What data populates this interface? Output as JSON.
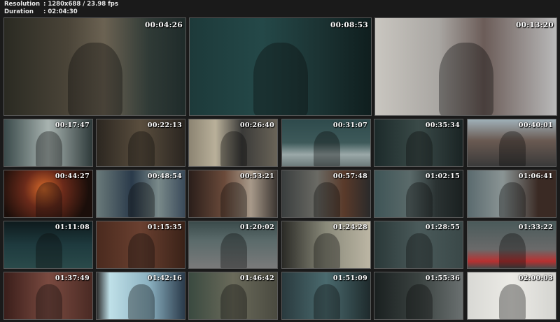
{
  "header": {
    "resolution_label": "Resolution",
    "resolution_value": ": 1280x688 / 23.98 fps",
    "duration_label": "Duration",
    "duration_value": ": 02:04:30"
  },
  "thumbnails": [
    {
      "time": "00:04:26",
      "bg": "linear-gradient(90deg,#2a2a22 0%,#4a4438 35%,#6b6252 55%,#2f3a36 80%,#1f2b2a 100%)"
    },
    {
      "time": "00:08:53",
      "bg": "linear-gradient(90deg,#1d3a3a 0%,#244848 40%,#1c3434 70%,#0f1e1e 100%)"
    },
    {
      "time": "00:13:20",
      "bg": "linear-gradient(90deg,#c9c6c0 0%,#a9a6a2 35%,#6b5c58 60%,#b9b9b9 100%)"
    },
    {
      "time": "00:17:47",
      "bg": "linear-gradient(90deg,#3a4a4a,#a8b3b0 50%,#2e3a3a)"
    },
    {
      "time": "00:22:13",
      "bg": "linear-gradient(90deg,#2b2620,#5a4e3e 50%,#2a2520)"
    },
    {
      "time": "00:26:40",
      "bg": "linear-gradient(90deg,#8c8472,#b9b09a 30%,#3a3a38 60%,#6a6458)"
    },
    {
      "time": "00:31:07",
      "bg": "linear-gradient(180deg,#2e4a4c 0%,#3e5a5a 50%,#9aa8a8 75%,#6c7a7a 100%)"
    },
    {
      "time": "00:35:34",
      "bg": "linear-gradient(90deg,#1c2a2a,#3a4a48 50%,#1a2424)"
    },
    {
      "time": "00:40:01",
      "bg": "linear-gradient(180deg,#9fb0b8 0%,#6a5a52 45%,#3a3a3a 100%)"
    },
    {
      "time": "00:44:27",
      "bg": "radial-gradient(circle at 45% 40%,#d86a2a 0%,#6a2a1a 35%,#1a0e0a 80%)"
    },
    {
      "time": "00:48:54",
      "bg": "linear-gradient(90deg,#6a7a7a,#2a3a4a 40%,#7a8a8a 70%,#3a4a5a)"
    },
    {
      "time": "00:53:21",
      "bg": "linear-gradient(90deg,#2a1e1a,#6a4a3a 40%,#a89a8a 70%,#3a3430)"
    },
    {
      "time": "00:57:48",
      "bg": "linear-gradient(90deg,#3a3e3e,#6a6a64 40%,#5a3a2a 70%,#2a2a2a)"
    },
    {
      "time": "01:02:15",
      "bg": "linear-gradient(90deg,#3e5456,#5a6a6a 40%,#2a3232 70%,#1a2020)"
    },
    {
      "time": "01:06:41",
      "bg": "linear-gradient(90deg,#5a6a6e,#8a9494 40%,#3a2a24 80%)"
    },
    {
      "time": "01:11:08",
      "bg": "linear-gradient(180deg,#0e1a1c 0%,#1e3a3e 50%,#2a4a4a 100%)"
    },
    {
      "time": "01:15:35",
      "bg": "linear-gradient(90deg,#4a2a1e,#6a4030 50%,#3a2218)"
    },
    {
      "time": "01:20:02",
      "bg": "linear-gradient(180deg,#3a4a4a 0%,#5a6a6a 40%,#7a7a7a 100%)"
    },
    {
      "time": "01:24:28",
      "bg": "linear-gradient(90deg,#2a2a26,#8a8a7a 50%,#bcb6a4)"
    },
    {
      "time": "01:28:55",
      "bg": "linear-gradient(90deg,#2a3838,#4a5a5a 50%,#3a4848)"
    },
    {
      "time": "01:33:22",
      "bg": "linear-gradient(180deg,#4a5a5a 0%,#6a6a6a 60%,#b83030 85%,#4a4a4a 100%)"
    },
    {
      "time": "01:37:49",
      "bg": "linear-gradient(90deg,#3a1e1a,#7a4a40 50%,#4a2a24)"
    },
    {
      "time": "01:42:16",
      "bg": "linear-gradient(90deg,#2a2a2a 0%,#bfe0e8 15%,#8ab0c0 60%,#2a3a4a 100%)"
    },
    {
      "time": "01:46:42",
      "bg": "linear-gradient(90deg,#3a4a40,#6a6a5a 50%,#4a4a40)"
    },
    {
      "time": "01:51:09",
      "bg": "linear-gradient(90deg,#2a3a3e,#4a6a6e 50%,#1e2a2c)"
    },
    {
      "time": "01:55:36",
      "bg": "linear-gradient(90deg,#1a2020,#3a4240 50%,#6a7070)"
    },
    {
      "time": "02:00:03",
      "bg": "linear-gradient(90deg,#d8d8d4,#ecebe6 50%,#d4d4d0)"
    }
  ]
}
